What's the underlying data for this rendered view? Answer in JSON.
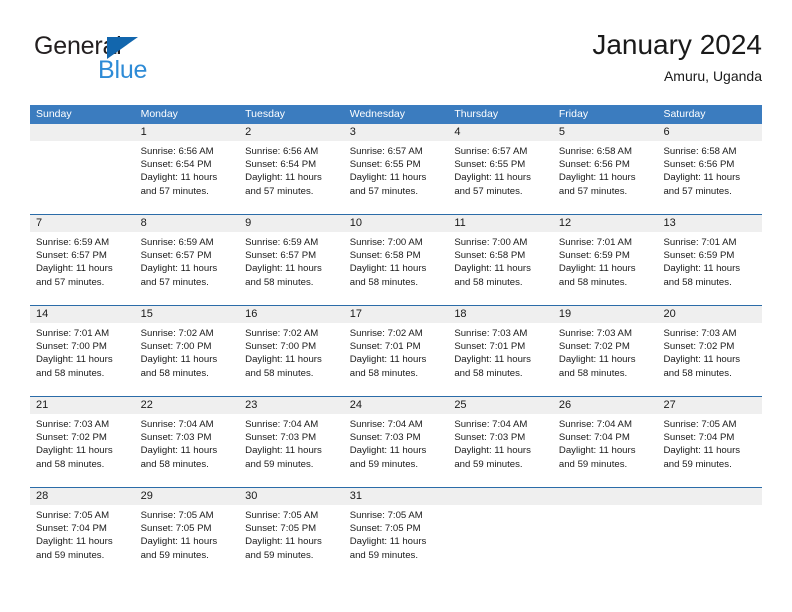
{
  "brand": {
    "name_part1": "General",
    "name_part2": "Blue",
    "triangle_color": "#1266ad",
    "blue_color": "#2e8bd6"
  },
  "header": {
    "title": "January 2024",
    "subtitle": "Amuru, Uganda"
  },
  "theme": {
    "header_bar": "#3b7cbf",
    "row_divider": "#2b6ca8",
    "day_number_bg": "#efefef",
    "text": "#1a1a1a"
  },
  "weekdays": [
    "Sunday",
    "Monday",
    "Tuesday",
    "Wednesday",
    "Thursday",
    "Friday",
    "Saturday"
  ],
  "weeks": [
    [
      {
        "day": "",
        "sunrise": "",
        "sunset": "",
        "daylight_line1": "",
        "daylight_line2": ""
      },
      {
        "day": "1",
        "sunrise": "Sunrise: 6:56 AM",
        "sunset": "Sunset: 6:54 PM",
        "daylight_line1": "Daylight: 11 hours",
        "daylight_line2": "and 57 minutes."
      },
      {
        "day": "2",
        "sunrise": "Sunrise: 6:56 AM",
        "sunset": "Sunset: 6:54 PM",
        "daylight_line1": "Daylight: 11 hours",
        "daylight_line2": "and 57 minutes."
      },
      {
        "day": "3",
        "sunrise": "Sunrise: 6:57 AM",
        "sunset": "Sunset: 6:55 PM",
        "daylight_line1": "Daylight: 11 hours",
        "daylight_line2": "and 57 minutes."
      },
      {
        "day": "4",
        "sunrise": "Sunrise: 6:57 AM",
        "sunset": "Sunset: 6:55 PM",
        "daylight_line1": "Daylight: 11 hours",
        "daylight_line2": "and 57 minutes."
      },
      {
        "day": "5",
        "sunrise": "Sunrise: 6:58 AM",
        "sunset": "Sunset: 6:56 PM",
        "daylight_line1": "Daylight: 11 hours",
        "daylight_line2": "and 57 minutes."
      },
      {
        "day": "6",
        "sunrise": "Sunrise: 6:58 AM",
        "sunset": "Sunset: 6:56 PM",
        "daylight_line1": "Daylight: 11 hours",
        "daylight_line2": "and 57 minutes."
      }
    ],
    [
      {
        "day": "7",
        "sunrise": "Sunrise: 6:59 AM",
        "sunset": "Sunset: 6:57 PM",
        "daylight_line1": "Daylight: 11 hours",
        "daylight_line2": "and 57 minutes."
      },
      {
        "day": "8",
        "sunrise": "Sunrise: 6:59 AM",
        "sunset": "Sunset: 6:57 PM",
        "daylight_line1": "Daylight: 11 hours",
        "daylight_line2": "and 57 minutes."
      },
      {
        "day": "9",
        "sunrise": "Sunrise: 6:59 AM",
        "sunset": "Sunset: 6:57 PM",
        "daylight_line1": "Daylight: 11 hours",
        "daylight_line2": "and 58 minutes."
      },
      {
        "day": "10",
        "sunrise": "Sunrise: 7:00 AM",
        "sunset": "Sunset: 6:58 PM",
        "daylight_line1": "Daylight: 11 hours",
        "daylight_line2": "and 58 minutes."
      },
      {
        "day": "11",
        "sunrise": "Sunrise: 7:00 AM",
        "sunset": "Sunset: 6:58 PM",
        "daylight_line1": "Daylight: 11 hours",
        "daylight_line2": "and 58 minutes."
      },
      {
        "day": "12",
        "sunrise": "Sunrise: 7:01 AM",
        "sunset": "Sunset: 6:59 PM",
        "daylight_line1": "Daylight: 11 hours",
        "daylight_line2": "and 58 minutes."
      },
      {
        "day": "13",
        "sunrise": "Sunrise: 7:01 AM",
        "sunset": "Sunset: 6:59 PM",
        "daylight_line1": "Daylight: 11 hours",
        "daylight_line2": "and 58 minutes."
      }
    ],
    [
      {
        "day": "14",
        "sunrise": "Sunrise: 7:01 AM",
        "sunset": "Sunset: 7:00 PM",
        "daylight_line1": "Daylight: 11 hours",
        "daylight_line2": "and 58 minutes."
      },
      {
        "day": "15",
        "sunrise": "Sunrise: 7:02 AM",
        "sunset": "Sunset: 7:00 PM",
        "daylight_line1": "Daylight: 11 hours",
        "daylight_line2": "and 58 minutes."
      },
      {
        "day": "16",
        "sunrise": "Sunrise: 7:02 AM",
        "sunset": "Sunset: 7:00 PM",
        "daylight_line1": "Daylight: 11 hours",
        "daylight_line2": "and 58 minutes."
      },
      {
        "day": "17",
        "sunrise": "Sunrise: 7:02 AM",
        "sunset": "Sunset: 7:01 PM",
        "daylight_line1": "Daylight: 11 hours",
        "daylight_line2": "and 58 minutes."
      },
      {
        "day": "18",
        "sunrise": "Sunrise: 7:03 AM",
        "sunset": "Sunset: 7:01 PM",
        "daylight_line1": "Daylight: 11 hours",
        "daylight_line2": "and 58 minutes."
      },
      {
        "day": "19",
        "sunrise": "Sunrise: 7:03 AM",
        "sunset": "Sunset: 7:02 PM",
        "daylight_line1": "Daylight: 11 hours",
        "daylight_line2": "and 58 minutes."
      },
      {
        "day": "20",
        "sunrise": "Sunrise: 7:03 AM",
        "sunset": "Sunset: 7:02 PM",
        "daylight_line1": "Daylight: 11 hours",
        "daylight_line2": "and 58 minutes."
      }
    ],
    [
      {
        "day": "21",
        "sunrise": "Sunrise: 7:03 AM",
        "sunset": "Sunset: 7:02 PM",
        "daylight_line1": "Daylight: 11 hours",
        "daylight_line2": "and 58 minutes."
      },
      {
        "day": "22",
        "sunrise": "Sunrise: 7:04 AM",
        "sunset": "Sunset: 7:03 PM",
        "daylight_line1": "Daylight: 11 hours",
        "daylight_line2": "and 58 minutes."
      },
      {
        "day": "23",
        "sunrise": "Sunrise: 7:04 AM",
        "sunset": "Sunset: 7:03 PM",
        "daylight_line1": "Daylight: 11 hours",
        "daylight_line2": "and 59 minutes."
      },
      {
        "day": "24",
        "sunrise": "Sunrise: 7:04 AM",
        "sunset": "Sunset: 7:03 PM",
        "daylight_line1": "Daylight: 11 hours",
        "daylight_line2": "and 59 minutes."
      },
      {
        "day": "25",
        "sunrise": "Sunrise: 7:04 AM",
        "sunset": "Sunset: 7:03 PM",
        "daylight_line1": "Daylight: 11 hours",
        "daylight_line2": "and 59 minutes."
      },
      {
        "day": "26",
        "sunrise": "Sunrise: 7:04 AM",
        "sunset": "Sunset: 7:04 PM",
        "daylight_line1": "Daylight: 11 hours",
        "daylight_line2": "and 59 minutes."
      },
      {
        "day": "27",
        "sunrise": "Sunrise: 7:05 AM",
        "sunset": "Sunset: 7:04 PM",
        "daylight_line1": "Daylight: 11 hours",
        "daylight_line2": "and 59 minutes."
      }
    ],
    [
      {
        "day": "28",
        "sunrise": "Sunrise: 7:05 AM",
        "sunset": "Sunset: 7:04 PM",
        "daylight_line1": "Daylight: 11 hours",
        "daylight_line2": "and 59 minutes."
      },
      {
        "day": "29",
        "sunrise": "Sunrise: 7:05 AM",
        "sunset": "Sunset: 7:05 PM",
        "daylight_line1": "Daylight: 11 hours",
        "daylight_line2": "and 59 minutes."
      },
      {
        "day": "30",
        "sunrise": "Sunrise: 7:05 AM",
        "sunset": "Sunset: 7:05 PM",
        "daylight_line1": "Daylight: 11 hours",
        "daylight_line2": "and 59 minutes."
      },
      {
        "day": "31",
        "sunrise": "Sunrise: 7:05 AM",
        "sunset": "Sunset: 7:05 PM",
        "daylight_line1": "Daylight: 11 hours",
        "daylight_line2": "and 59 minutes."
      },
      {
        "day": "",
        "sunrise": "",
        "sunset": "",
        "daylight_line1": "",
        "daylight_line2": ""
      },
      {
        "day": "",
        "sunrise": "",
        "sunset": "",
        "daylight_line1": "",
        "daylight_line2": ""
      },
      {
        "day": "",
        "sunrise": "",
        "sunset": "",
        "daylight_line1": "",
        "daylight_line2": ""
      }
    ]
  ]
}
